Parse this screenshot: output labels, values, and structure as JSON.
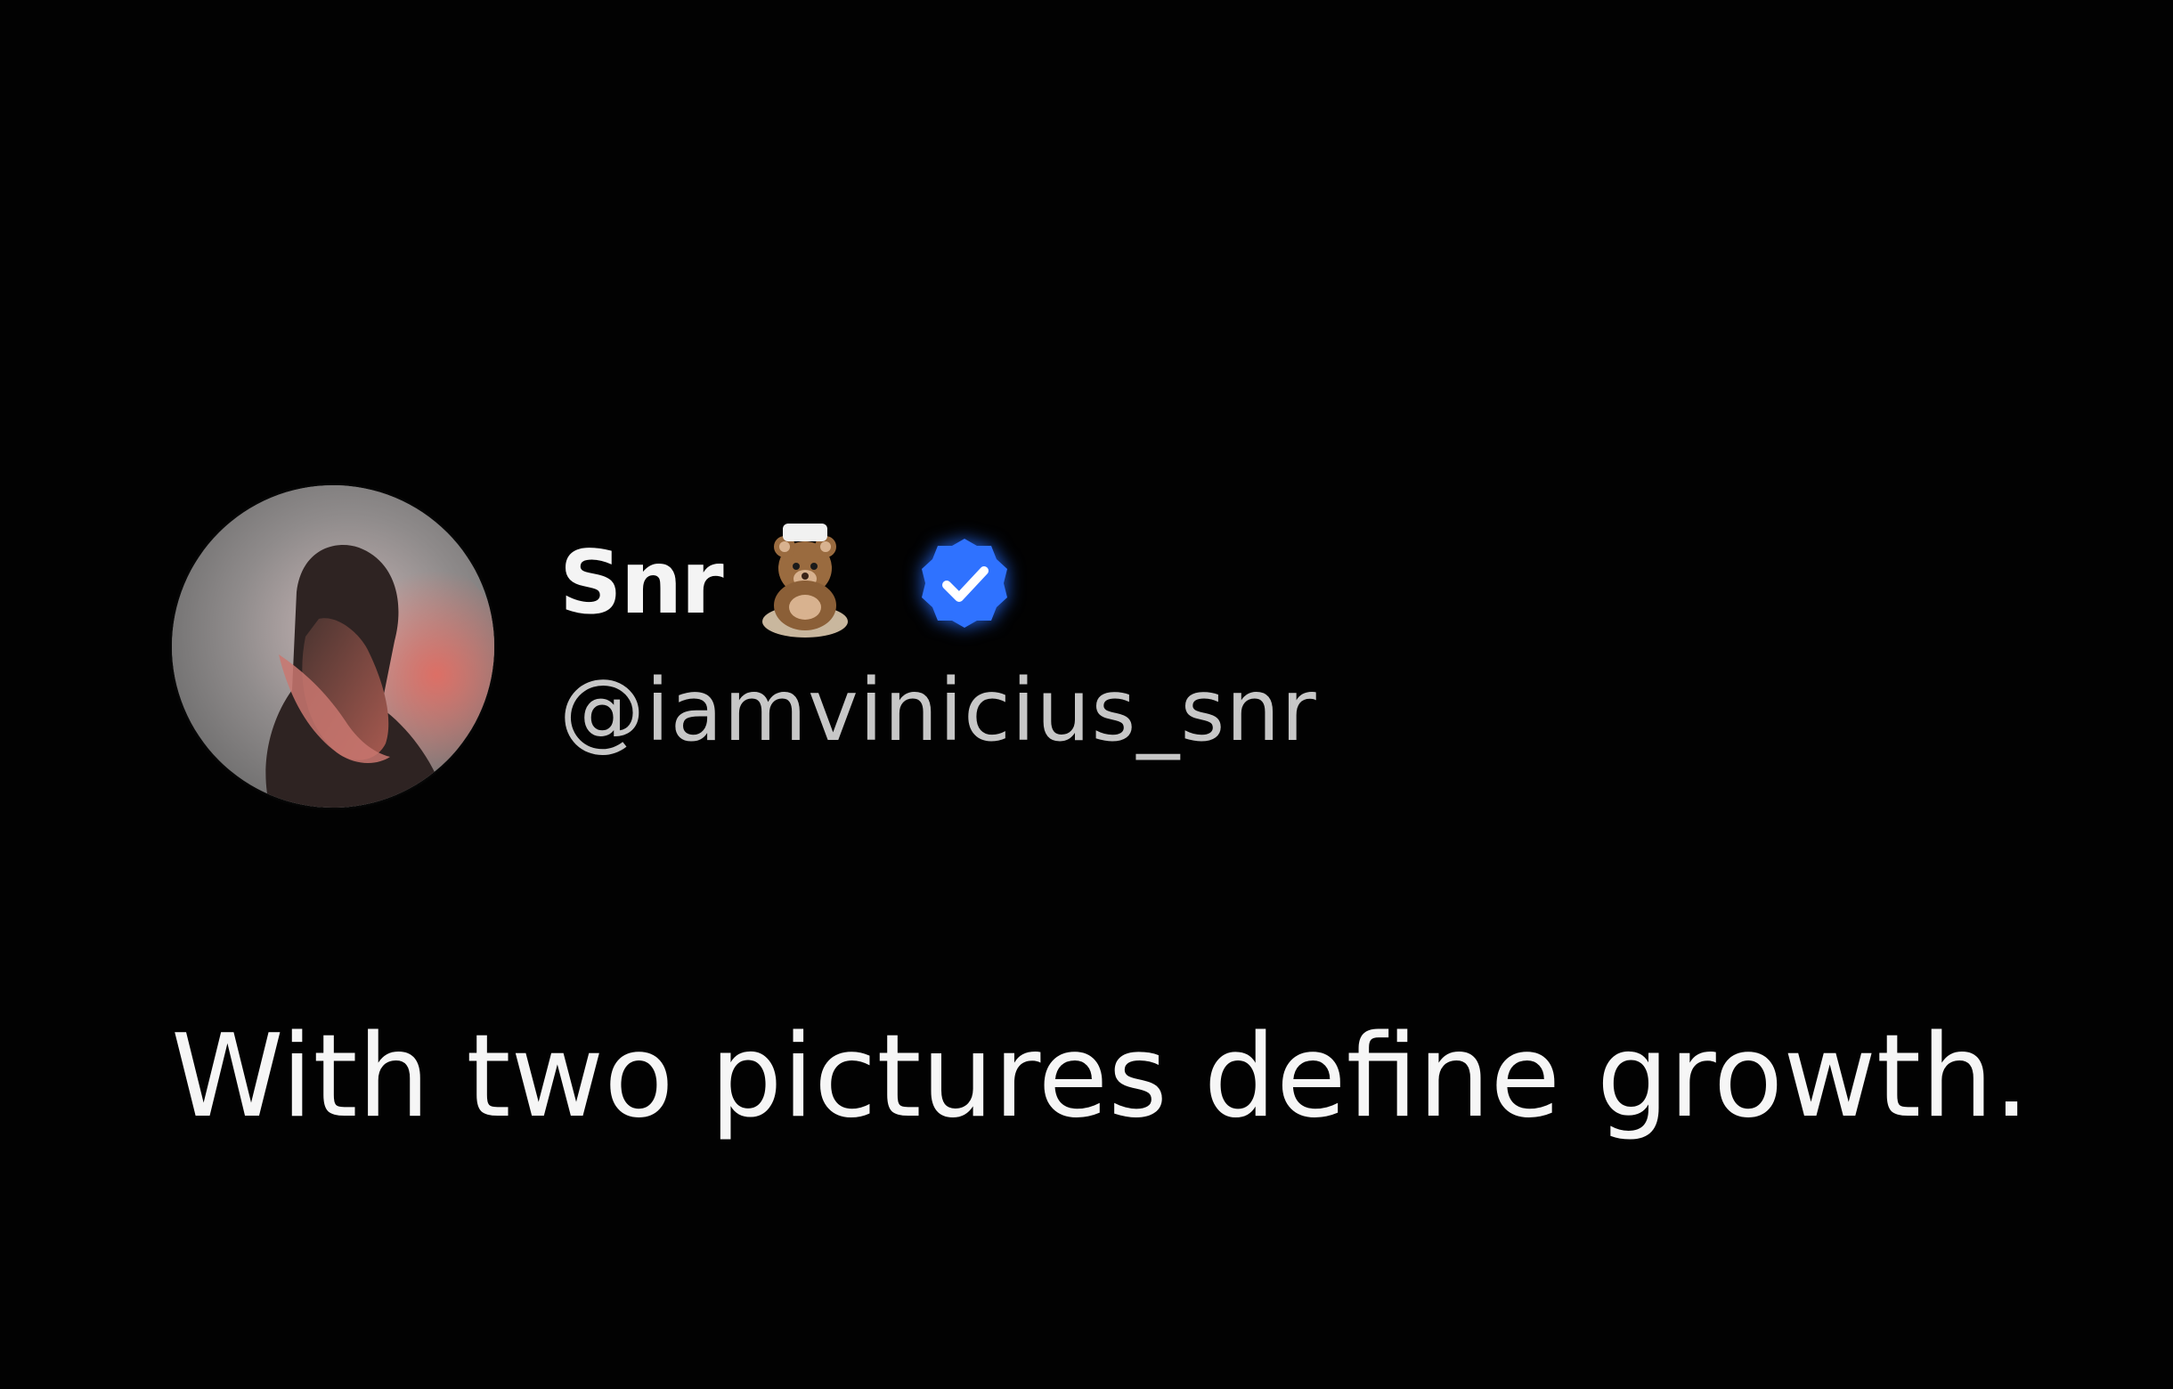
{
  "post": {
    "author": {
      "display_name": "Snr",
      "name_emoji_icon": "teddy-bear-icon",
      "verified_icon": "verified-badge-icon",
      "handle": "@iamvinicius_snr",
      "avatar_icon": "profile-avatar"
    },
    "text": "With two pictures define growth."
  },
  "colors": {
    "background": "#020202",
    "display_name": "#f4f4f4",
    "handle": "#c7c7c7",
    "post_text": "#f6f6f6",
    "verified_badge": "#2f72ff"
  }
}
